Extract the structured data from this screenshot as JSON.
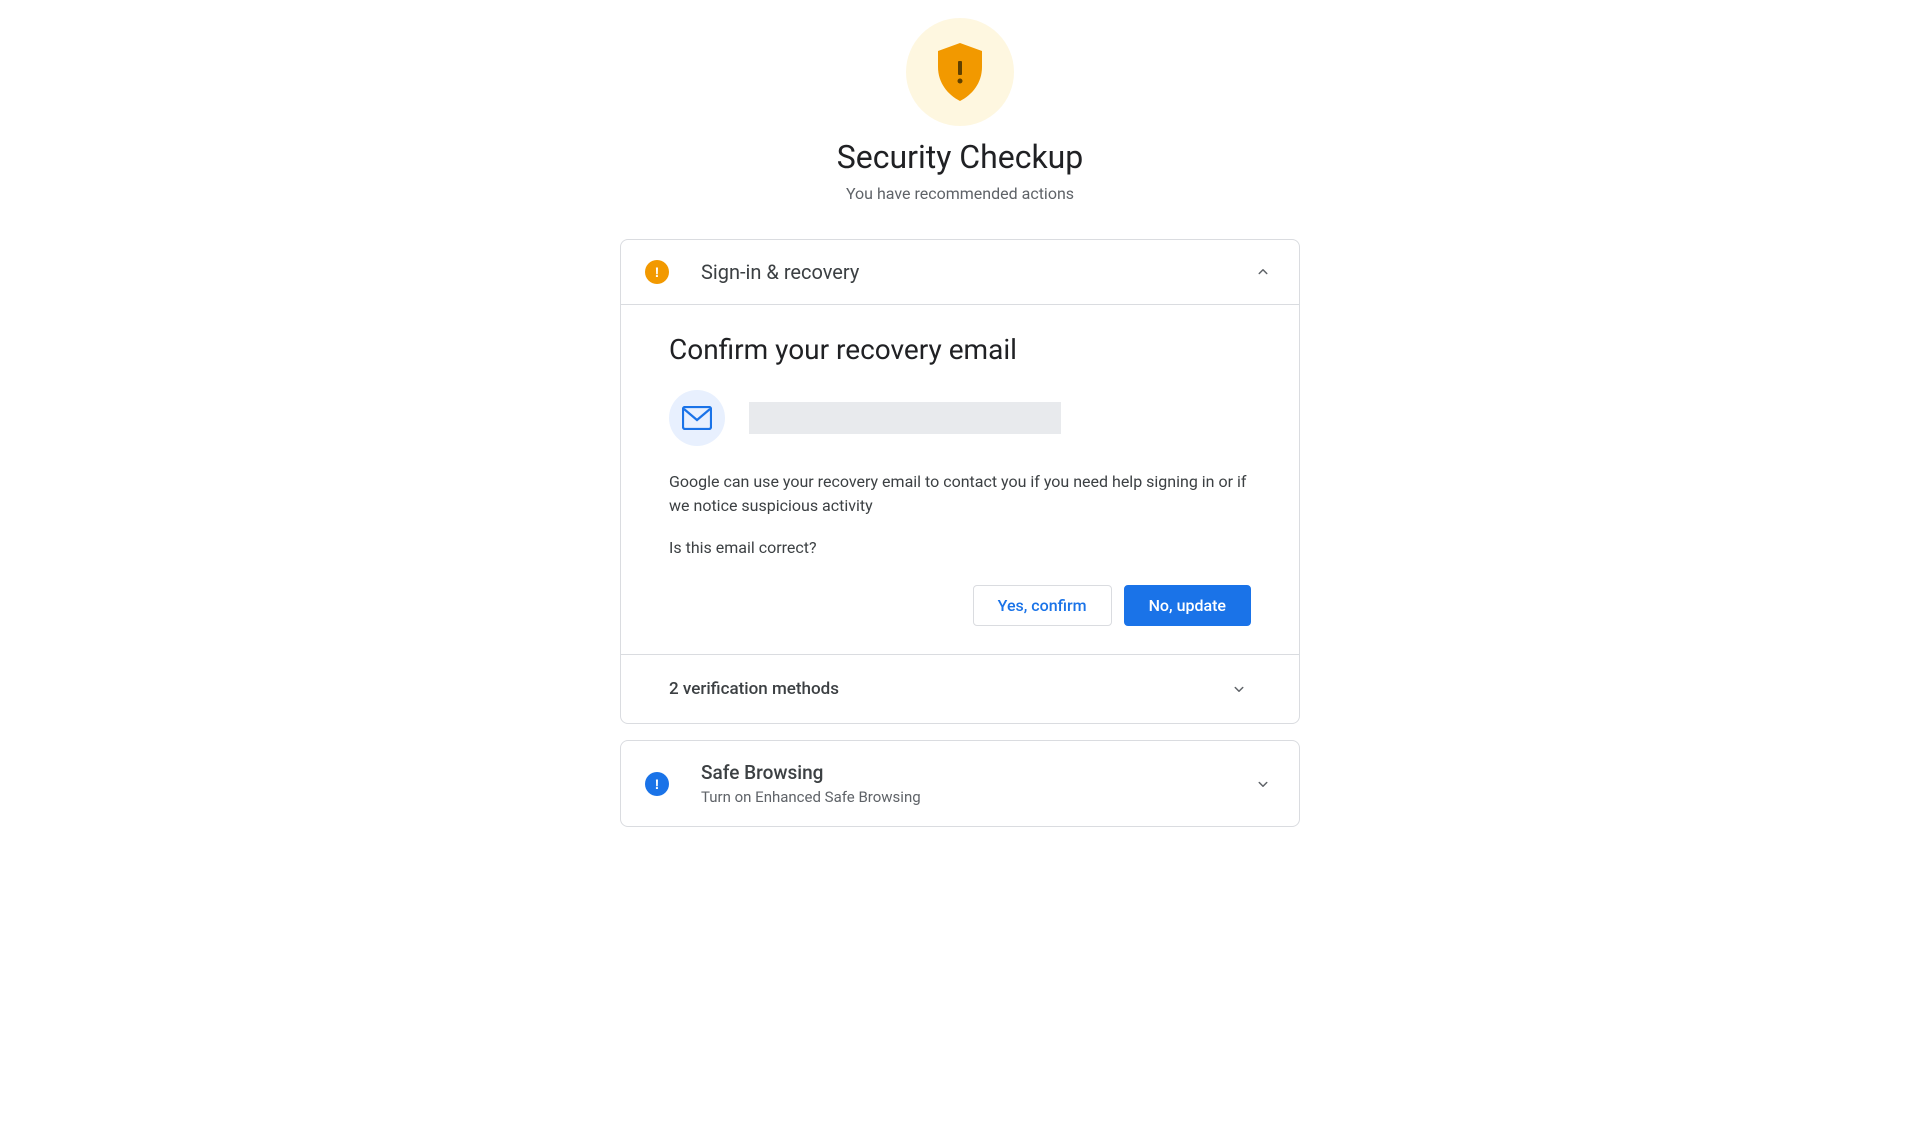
{
  "header": {
    "title": "Security Checkup",
    "subtitle": "You have recommended actions"
  },
  "sections": {
    "signin_recovery": {
      "title": "Sign-in & recovery",
      "body": {
        "title": "Confirm your recovery email",
        "description": "Google can use your recovery email to contact you if you need help signing in or if we notice suspicious activity",
        "question": "Is this email correct?",
        "confirm_label": "Yes, confirm",
        "update_label": "No, update"
      },
      "subsection": {
        "title": "2 verification methods"
      }
    },
    "safe_browsing": {
      "title": "Safe Browsing",
      "subtitle": "Turn on Enhanced Safe Browsing"
    }
  }
}
